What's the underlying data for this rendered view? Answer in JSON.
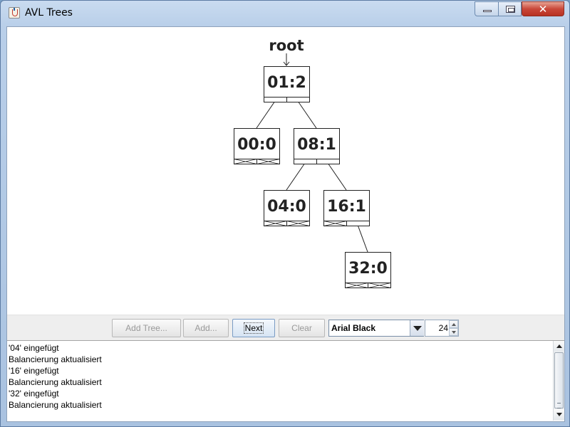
{
  "window": {
    "title": "AVL Trees"
  },
  "tree": {
    "root_label": "root",
    "nodes": [
      {
        "id": "n01",
        "label": "01:2",
        "left_child_null": false,
        "right_child_null": false
      },
      {
        "id": "n00",
        "label": "00:0",
        "left_child_null": true,
        "right_child_null": true
      },
      {
        "id": "n08",
        "label": "08:1",
        "left_child_null": false,
        "right_child_null": false
      },
      {
        "id": "n04",
        "label": "04:0",
        "left_child_null": true,
        "right_child_null": true
      },
      {
        "id": "n16",
        "label": "16:1",
        "left_child_null": true,
        "right_child_null": false
      },
      {
        "id": "n32",
        "label": "32:0",
        "left_child_null": true,
        "right_child_null": true
      }
    ],
    "edges": [
      {
        "from": "n01",
        "to": "n00"
      },
      {
        "from": "n01",
        "to": "n08"
      },
      {
        "from": "n08",
        "to": "n04"
      },
      {
        "from": "n08",
        "to": "n16"
      },
      {
        "from": "n16",
        "to": "n32"
      }
    ]
  },
  "toolbar": {
    "add_tree": "Add Tree...",
    "add": "Add...",
    "next": "Next",
    "clear": "Clear",
    "font_name": "Arial Black",
    "font_size": "24"
  },
  "log": {
    "lines": [
      "'04' eingefügt",
      "Balancierung aktualisiert",
      "'16' eingefügt",
      "Balancierung aktualisiert",
      "'32' eingefügt",
      "Balancierung aktualisiert"
    ]
  }
}
